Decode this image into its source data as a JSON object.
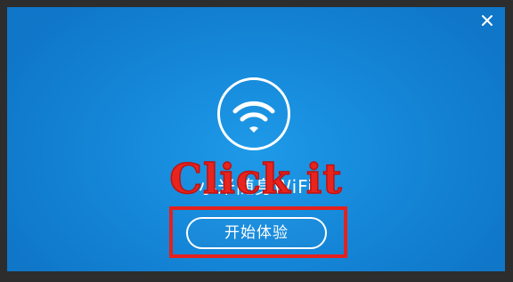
{
  "dialog": {
    "close_icon": "close-icon",
    "logo_icon": "wifi-icon",
    "app_name": "小米随身WiFi",
    "start_button_label": "开始体验"
  },
  "annotation": {
    "text": "Click it",
    "color": "#e5201d"
  },
  "colors": {
    "background": "#1689da",
    "frame": "#2d2d2d",
    "foreground": "#ffffff"
  }
}
